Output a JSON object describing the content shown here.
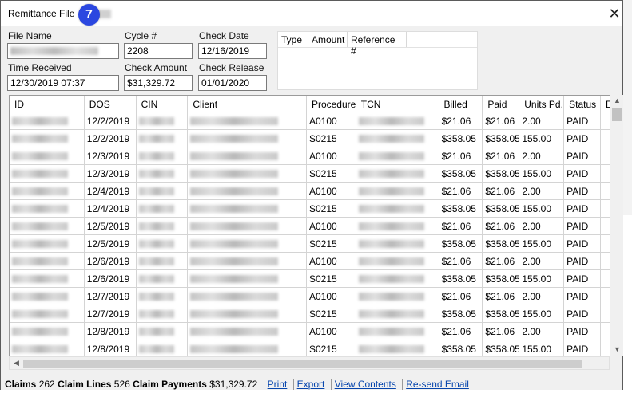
{
  "window": {
    "title": "Remittance File",
    "badge": "7",
    "close_glyph": "✕"
  },
  "fields": {
    "file_name_label": "File Name",
    "cycle_label": "Cycle #",
    "cycle_value": "2208",
    "check_date_label": "Check Date",
    "check_date_value": "12/16/2019",
    "time_received_label": "Time Received",
    "time_received_value": "12/30/2019 07:37",
    "check_amount_label": "Check Amount",
    "check_amount_value": "$31,329.72",
    "check_release_label": "Check Release",
    "check_release_value": "01/01/2020"
  },
  "payments_table": {
    "headers": [
      "Type",
      "Amount",
      "Reference #"
    ]
  },
  "grid": {
    "headers": [
      "ID",
      "DOS",
      "CIN",
      "Client",
      "Procedure",
      "TCN",
      "Billed",
      "Paid",
      "Units Pd.",
      "Status",
      "E"
    ],
    "rows": [
      [
        "12/2/2019",
        "A0100",
        "$21.06",
        "$21.06",
        "2.00",
        "PAID"
      ],
      [
        "12/2/2019",
        "S0215",
        "$358.05",
        "$358.05",
        "155.00",
        "PAID"
      ],
      [
        "12/3/2019",
        "A0100",
        "$21.06",
        "$21.06",
        "2.00",
        "PAID"
      ],
      [
        "12/3/2019",
        "S0215",
        "$358.05",
        "$358.05",
        "155.00",
        "PAID"
      ],
      [
        "12/4/2019",
        "A0100",
        "$21.06",
        "$21.06",
        "2.00",
        "PAID"
      ],
      [
        "12/4/2019",
        "S0215",
        "$358.05",
        "$358.05",
        "155.00",
        "PAID"
      ],
      [
        "12/5/2019",
        "A0100",
        "$21.06",
        "$21.06",
        "2.00",
        "PAID"
      ],
      [
        "12/5/2019",
        "S0215",
        "$358.05",
        "$358.05",
        "155.00",
        "PAID"
      ],
      [
        "12/6/2019",
        "A0100",
        "$21.06",
        "$21.06",
        "2.00",
        "PAID"
      ],
      [
        "12/6/2019",
        "S0215",
        "$358.05",
        "$358.05",
        "155.00",
        "PAID"
      ],
      [
        "12/7/2019",
        "A0100",
        "$21.06",
        "$21.06",
        "2.00",
        "PAID"
      ],
      [
        "12/7/2019",
        "S0215",
        "$358.05",
        "$358.05",
        "155.00",
        "PAID"
      ],
      [
        "12/8/2019",
        "A0100",
        "$21.06",
        "$21.06",
        "2.00",
        "PAID"
      ],
      [
        "12/8/2019",
        "S0215",
        "$358.05",
        "$358.05",
        "155.00",
        "PAID"
      ]
    ]
  },
  "footer": {
    "claims_label": "Claims",
    "claims_value": "262",
    "claim_lines_label": "Claim Lines",
    "claim_lines_value": "526",
    "claim_payments_label": "Claim Payments",
    "claim_payments_value": "$31,329.72",
    "links": [
      "Print",
      "Export",
      "View Contents",
      "Re-send Email"
    ]
  },
  "colors": {
    "badge": "#2b47e0",
    "link": "#0645ad"
  }
}
